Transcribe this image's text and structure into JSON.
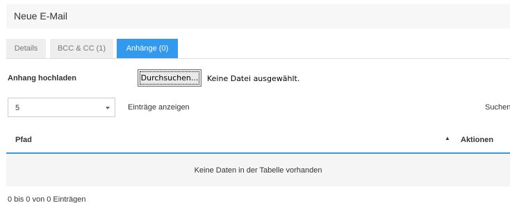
{
  "modal": {
    "title": "Neue E-Mail"
  },
  "tabs": [
    {
      "label": "Details",
      "active": false
    },
    {
      "label": "BCC & CC (1)",
      "active": false
    },
    {
      "label": "Anhänge (0)",
      "active": true
    }
  ],
  "upload": {
    "label": "Anhang hochladen",
    "browse_label": "Durchsuchen...",
    "file_status": "Keine Datei ausgewählt."
  },
  "table_controls": {
    "length_value": "5",
    "length_label": "Einträge anzeigen",
    "search_label": "Suchen"
  },
  "table": {
    "columns": [
      "Pfad",
      "Aktionen"
    ],
    "sort_icon": "sort-asc-icon",
    "empty_message": "Keine Daten in der Tabelle vorhanden"
  },
  "info": "0 bis 0 von 0 Einträgen",
  "colors": {
    "accent": "#3399ee",
    "tab_inactive": "#eeeeee",
    "header_bg": "#f7f7f7"
  }
}
